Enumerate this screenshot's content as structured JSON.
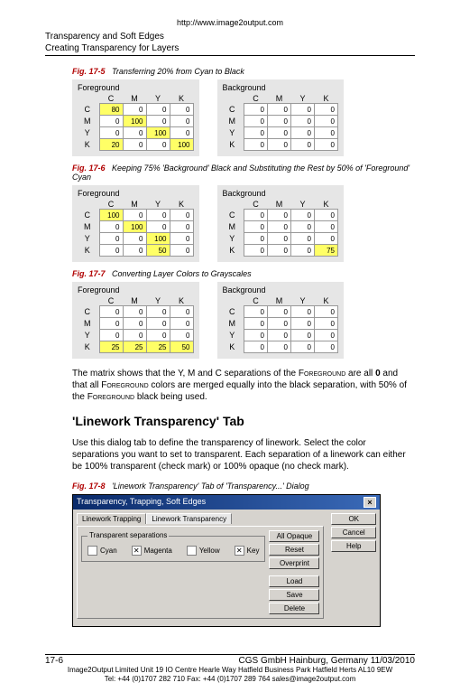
{
  "url": "http://www.image2output.com",
  "header": {
    "line1": "Transparency and Soft Edges",
    "line2": "Creating Transparency for Layers"
  },
  "figs": {
    "f5": {
      "num": "Fig. 17-5",
      "desc": "Transferring 20% from Cyan to Black"
    },
    "f6": {
      "num": "Fig. 17-6",
      "desc": "Keeping 75% 'Background' Black and Substituting the Rest by 50% of 'Foreground' Cyan"
    },
    "f7": {
      "num": "Fig. 17-7",
      "desc": "Converting Layer Colors to Grayscales"
    },
    "f8": {
      "num": "Fig. 17-8",
      "desc": "'Linework Transparency' Tab of 'Transparency...' Dialog"
    }
  },
  "matrix": {
    "fg_label": "Foreground",
    "bg_label": "Background",
    "cols": [
      "C",
      "M",
      "Y",
      "K"
    ],
    "rows": [
      "C",
      "M",
      "Y",
      "K"
    ],
    "f5_fg": [
      [
        {
          "v": "80",
          "hl": true
        },
        {
          "v": "0"
        },
        {
          "v": "0"
        },
        {
          "v": "0"
        }
      ],
      [
        {
          "v": "0"
        },
        {
          "v": "100",
          "hl": true
        },
        {
          "v": "0"
        },
        {
          "v": "0"
        }
      ],
      [
        {
          "v": "0"
        },
        {
          "v": "0"
        },
        {
          "v": "100",
          "hl": true
        },
        {
          "v": "0"
        }
      ],
      [
        {
          "v": "20",
          "hl": true
        },
        {
          "v": "0"
        },
        {
          "v": "0"
        },
        {
          "v": "100",
          "hl": true
        }
      ]
    ],
    "f5_bg": [
      [
        {
          "v": "0"
        },
        {
          "v": "0"
        },
        {
          "v": "0"
        },
        {
          "v": "0"
        }
      ],
      [
        {
          "v": "0"
        },
        {
          "v": "0"
        },
        {
          "v": "0"
        },
        {
          "v": "0"
        }
      ],
      [
        {
          "v": "0"
        },
        {
          "v": "0"
        },
        {
          "v": "0"
        },
        {
          "v": "0"
        }
      ],
      [
        {
          "v": "0"
        },
        {
          "v": "0"
        },
        {
          "v": "0"
        },
        {
          "v": "0"
        }
      ]
    ],
    "f6_fg": [
      [
        {
          "v": "100",
          "hl": true
        },
        {
          "v": "0"
        },
        {
          "v": "0"
        },
        {
          "v": "0"
        }
      ],
      [
        {
          "v": "0"
        },
        {
          "v": "100",
          "hl": true
        },
        {
          "v": "0"
        },
        {
          "v": "0"
        }
      ],
      [
        {
          "v": "0"
        },
        {
          "v": "0"
        },
        {
          "v": "100",
          "hl": true
        },
        {
          "v": "0"
        }
      ],
      [
        {
          "v": "0"
        },
        {
          "v": "0"
        },
        {
          "v": "50",
          "hl": true
        },
        {
          "v": "0"
        }
      ]
    ],
    "f6_bg": [
      [
        {
          "v": "0"
        },
        {
          "v": "0"
        },
        {
          "v": "0"
        },
        {
          "v": "0"
        }
      ],
      [
        {
          "v": "0"
        },
        {
          "v": "0"
        },
        {
          "v": "0"
        },
        {
          "v": "0"
        }
      ],
      [
        {
          "v": "0"
        },
        {
          "v": "0"
        },
        {
          "v": "0"
        },
        {
          "v": "0"
        }
      ],
      [
        {
          "v": "0"
        },
        {
          "v": "0"
        },
        {
          "v": "0"
        },
        {
          "v": "75",
          "hl": true
        }
      ]
    ],
    "f7_fg": [
      [
        {
          "v": "0"
        },
        {
          "v": "0"
        },
        {
          "v": "0"
        },
        {
          "v": "0"
        }
      ],
      [
        {
          "v": "0"
        },
        {
          "v": "0"
        },
        {
          "v": "0"
        },
        {
          "v": "0"
        }
      ],
      [
        {
          "v": "0"
        },
        {
          "v": "0"
        },
        {
          "v": "0"
        },
        {
          "v": "0"
        }
      ],
      [
        {
          "v": "25",
          "hl": true
        },
        {
          "v": "25",
          "hl": true
        },
        {
          "v": "25",
          "hl": true
        },
        {
          "v": "50",
          "hl": true
        }
      ]
    ],
    "f7_bg": [
      [
        {
          "v": "0"
        },
        {
          "v": "0"
        },
        {
          "v": "0"
        },
        {
          "v": "0"
        }
      ],
      [
        {
          "v": "0"
        },
        {
          "v": "0"
        },
        {
          "v": "0"
        },
        {
          "v": "0"
        }
      ],
      [
        {
          "v": "0"
        },
        {
          "v": "0"
        },
        {
          "v": "0"
        },
        {
          "v": "0"
        }
      ],
      [
        {
          "v": "0"
        },
        {
          "v": "0"
        },
        {
          "v": "0"
        },
        {
          "v": "0"
        }
      ]
    ]
  },
  "para1_a": "The matrix shows that the Y, M and C separations of the ",
  "para1_b": "Foreground",
  "para1_c": " are all ",
  "para1_d": "0",
  "para1_e": " and that all ",
  "para1_f": "Foreground",
  "para1_g": " colors are merged equally into the black separation, with 50% of the ",
  "para1_h": "Foreground",
  "para1_i": " black being used.",
  "section_title": "'Linework Transparency' Tab",
  "para2": "Use this dialog tab to define the transparency of linework. Select the color separations you want to set to transparent. Each separation of a linework can either be 100% transparent (check mark) or 100% opaque (no check mark).",
  "dialog": {
    "title": "Transparency, Trapping, Soft Edges",
    "tabs": [
      "Linework Trapping",
      "Linework Transparency"
    ],
    "group": "Transparent separations",
    "opts": [
      {
        "label": "Cyan",
        "chk": false
      },
      {
        "label": "Magenta",
        "chk": true
      },
      {
        "label": "Yellow",
        "chk": false
      },
      {
        "label": "Key",
        "chk": true
      }
    ],
    "side": [
      "All Opaque",
      "Reset",
      "Overprint",
      "Load",
      "Save",
      "Delete"
    ],
    "side2": [
      "OK",
      "Cancel",
      "Help"
    ]
  },
  "footer": {
    "page": "17-6",
    "company": "CGS GmbH   Hainburg, Germany   11/03/2010",
    "addr": "Image2Output Limited  Unit 19 IO Centre Hearle Way Hatfield Business Park Hatfield Herts AL10 9EW",
    "tel": "Tel: +44 (0)1707 282 710 Fax: +44 (0)1707 289 764 sales@image2output.com"
  }
}
